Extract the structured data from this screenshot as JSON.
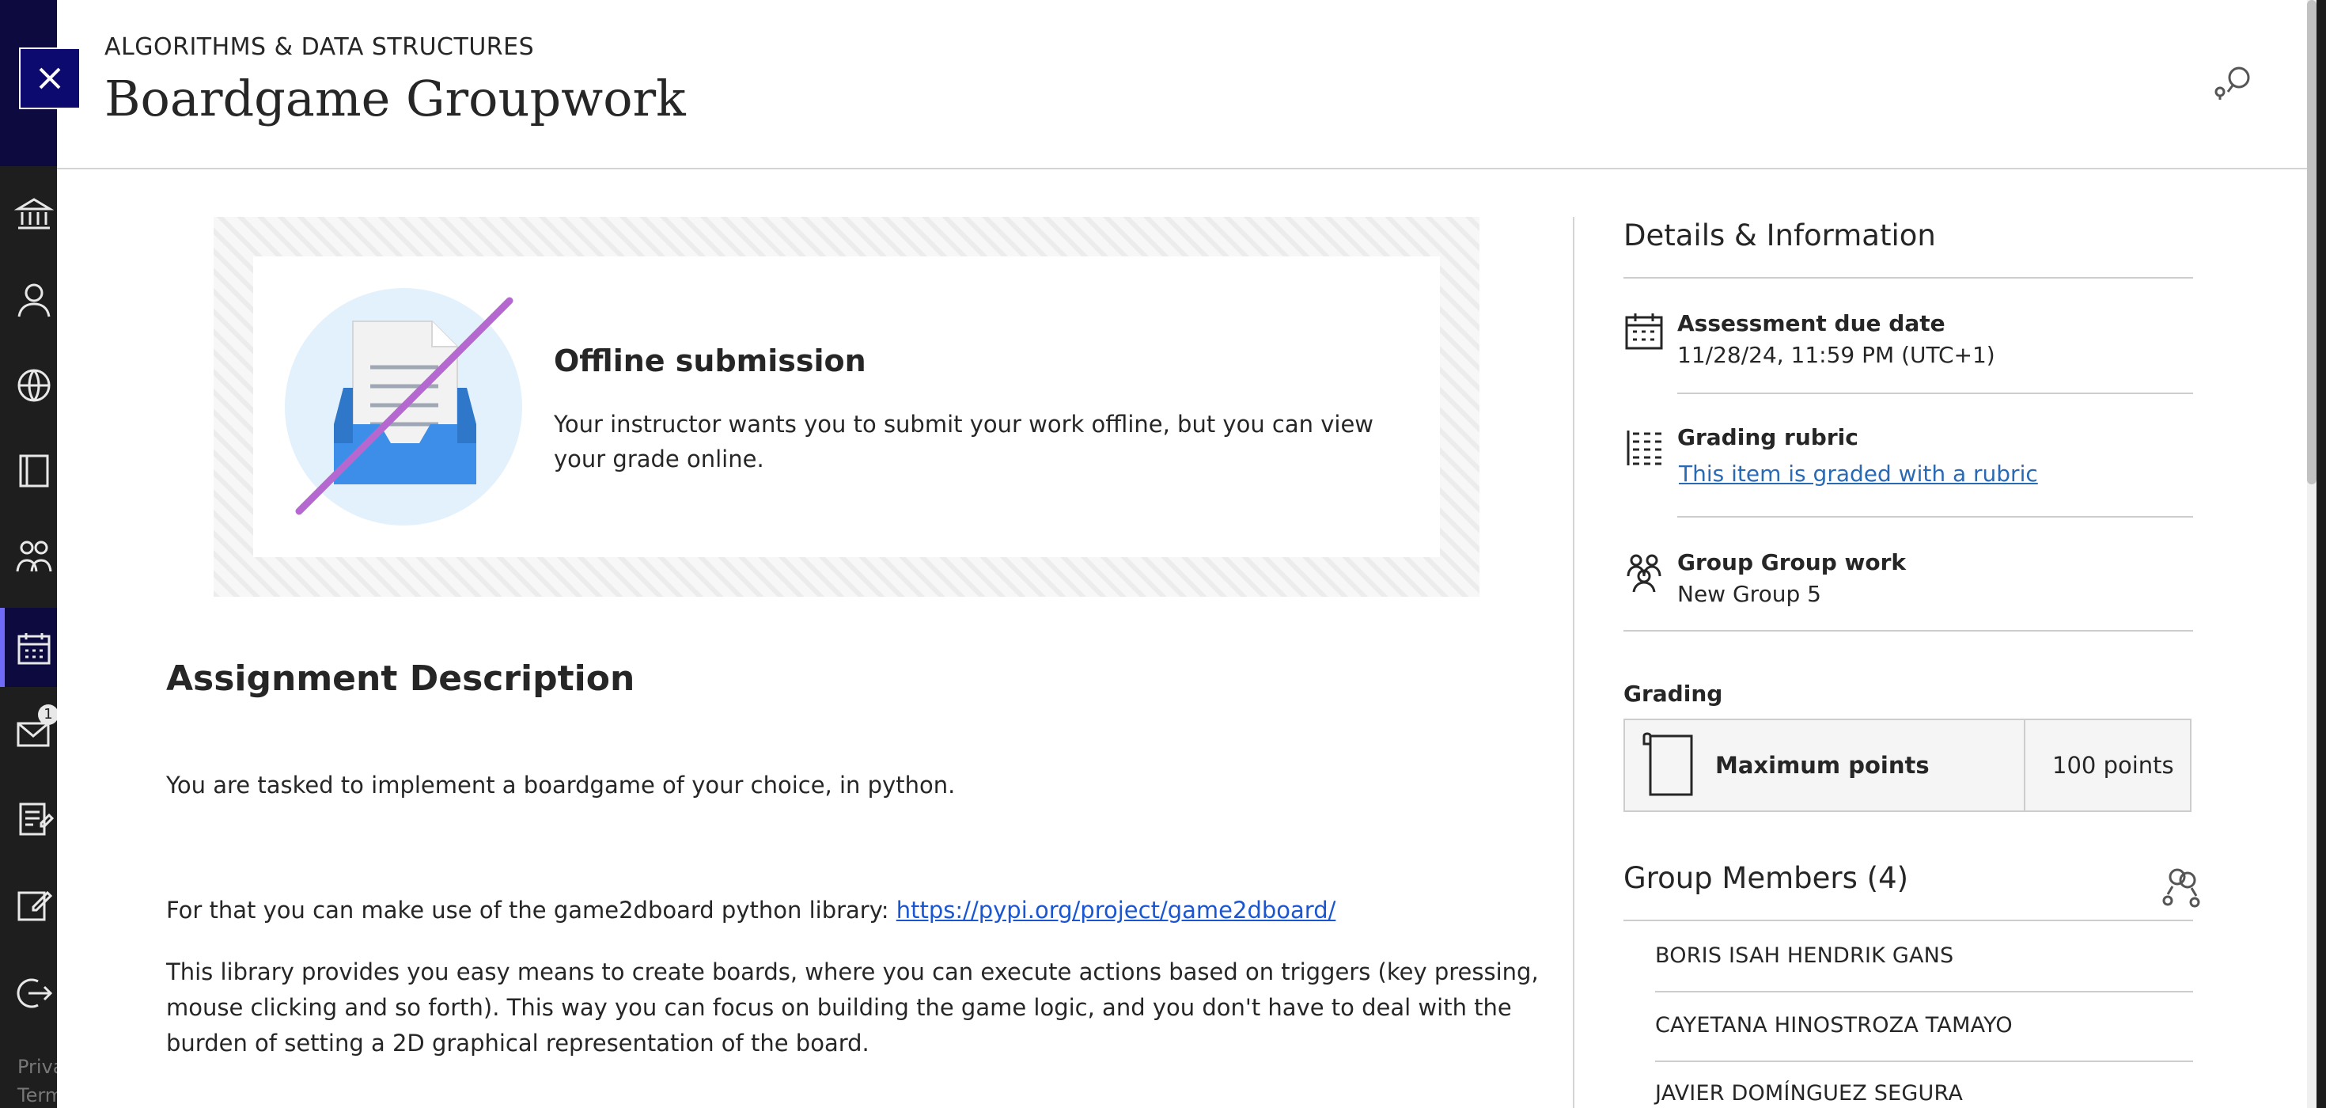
{
  "header": {
    "course_name": "ALGORITHMS & DATA STRUCTURES",
    "title": "Boardgame Groupwork"
  },
  "offline": {
    "title": "Offline submission",
    "text": "Your instructor wants you to submit your work offline, but you can view your grade online."
  },
  "description": {
    "heading": "Assignment Description",
    "para1": "You are tasked to implement a boardgame of your choice, in python.",
    "para2_prefix": "For that you can make use of the game2dboard python library: ",
    "para2_link": "https://pypi.org/project/game2dboard/",
    "para3": "This library provides you easy means to create boards, where you can execute actions based on triggers (key pressing, mouse clicking and so forth). This way you can focus on building the game logic, and you don't have to deal with the burden of setting a 2D graphical representation of the board."
  },
  "details": {
    "heading": "Details & Information",
    "due_label": "Assessment due date",
    "due_value": "11/28/24, 11:59 PM (UTC+1)",
    "rubric_label": "Grading rubric",
    "rubric_link": "This item is graded with a rubric",
    "group_label": "Group Group work",
    "group_value": "New Group 5"
  },
  "grading": {
    "heading": "Grading",
    "max_label": "Maximum points",
    "points": "100 points"
  },
  "group_members": {
    "heading": "Group Members (4)",
    "members": [
      "BORIS ISAH HENDRIK GANS",
      "CAYETANA HINOSTROZA TAMAYO",
      "JAVIER DOMÍNGUEZ SEGURA"
    ]
  },
  "rail": {
    "notification_count": "1",
    "footer_1": "Priva",
    "footer_2": "Term"
  },
  "icons": {
    "close": "close-icon",
    "header": "collaborate-icon",
    "due": "calendar-icon",
    "rubric": "rubric-icon",
    "group": "group-icon",
    "grading": "document-icon",
    "members": "members-icon"
  },
  "colors": {
    "accent": "#0c0a6e",
    "link": "#1a56d1",
    "rubric_link": "#2a6ab4",
    "illustration_circle": "#e3f1fc",
    "illustration_tray": "#3d8ee8",
    "strike": "#b569d0"
  }
}
